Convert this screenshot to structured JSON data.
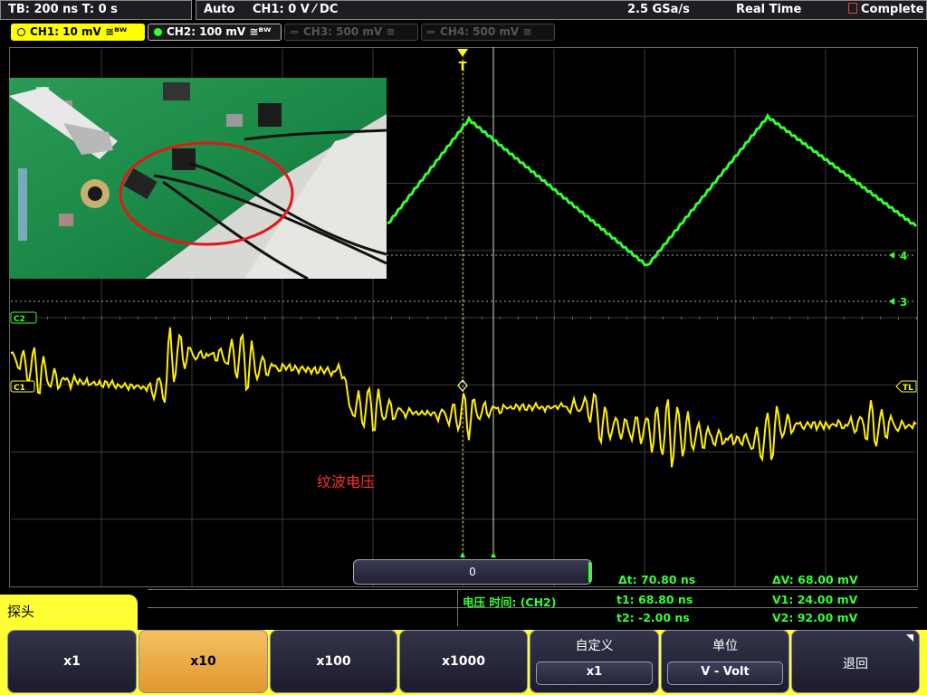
{
  "top_bar": {
    "timebase": "TB: 200 ns   T: 0 s",
    "trigger_mode": "Auto",
    "trigger": "CH1: 0 V ⁄ DC",
    "sample_rate": "2.5 GSa/s",
    "acq_mode": "Real Time",
    "status": "Complete"
  },
  "channels": [
    {
      "label": "CH1: 10 mV ≅ᴮᵂ",
      "color": "#ffff00"
    },
    {
      "label": "CH2: 100 mV ≅ᴮᵂ",
      "color": "#33ff33"
    },
    {
      "label": "CH3: 500 mV ≅",
      "color": "#555555"
    },
    {
      "label": "CH4: 500 mV ≅",
      "color": "#555555"
    }
  ],
  "markers": {
    "trigger_marker": "T",
    "ref4": "4",
    "ref3": "3",
    "c2": "C2",
    "c1": "C1",
    "tl": "TL"
  },
  "annotation": "纹波电压",
  "zoom_value": "0",
  "measurements": {
    "title": "电压 时间:  (CH2)",
    "dt": "Δt: 70.80 ns",
    "dv": "ΔV: 68.00 mV",
    "t1": "t1: 68.80 ns",
    "v1": "V1: 24.00 mV",
    "t2": "t2: -2.00 ns",
    "v2": "V2: 92.00 mV"
  },
  "softkey_menu_title": "探头",
  "softkeys": [
    {
      "label": "x1"
    },
    {
      "label": "x10",
      "selected": true
    },
    {
      "label": "x100"
    },
    {
      "label": "x1000"
    },
    {
      "title": "自定义",
      "value": "x1"
    },
    {
      "title": "单位",
      "value": "V - Volt"
    },
    {
      "label": "退回"
    }
  ]
}
